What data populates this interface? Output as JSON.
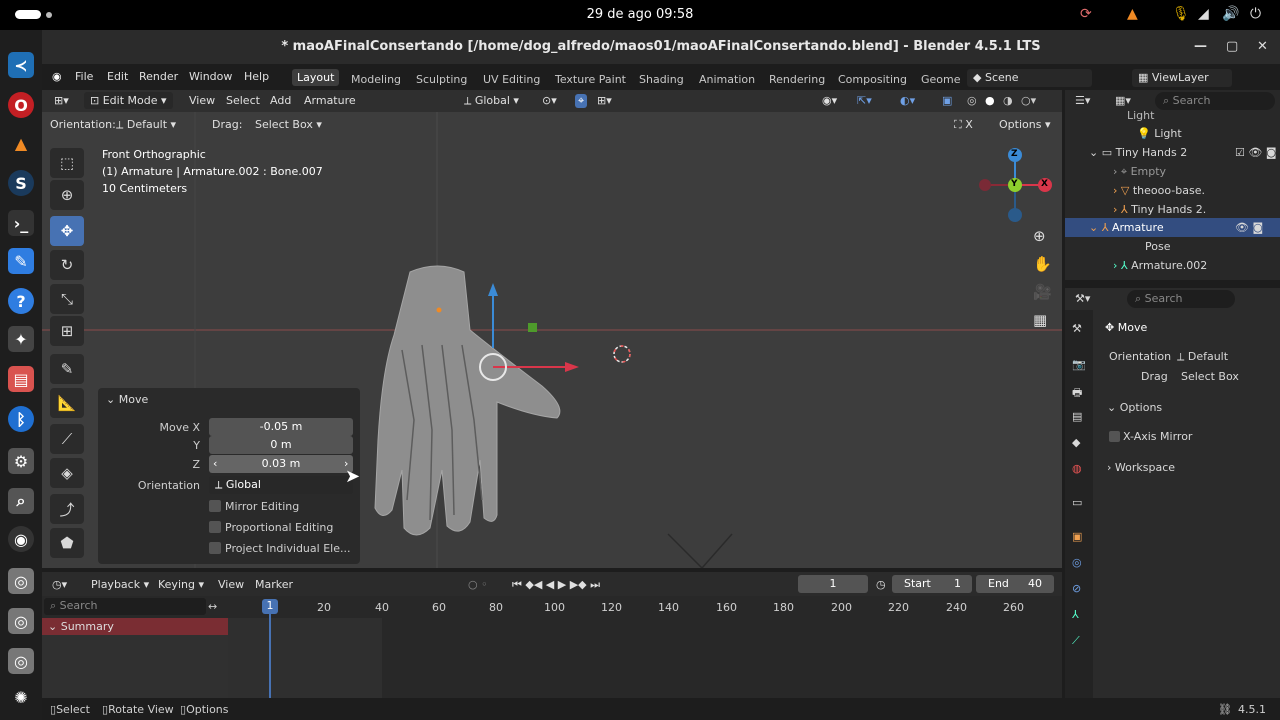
{
  "os": {
    "clock": "29 de ago  09:58"
  },
  "window": {
    "title": "* maoAFinalConsertando [/home/dog_alfredo/maos01/maoAFinalConsertando.blend] - Blender 4.5.1 LTS"
  },
  "menu": [
    "File",
    "Edit",
    "Render",
    "Window",
    "Help"
  ],
  "workspaces": [
    "Layout",
    "Modeling",
    "Sculpting",
    "UV Editing",
    "Texture Paint",
    "Shading",
    "Animation",
    "Rendering",
    "Compositing",
    "Geome"
  ],
  "scene": "Scene",
  "view_layer": "ViewLayer",
  "viewport": {
    "mode": "Edit Mode",
    "menus": [
      "View",
      "Select",
      "Add",
      "Armature"
    ],
    "transform_orientation": "Global",
    "orientation_label": "Orientation:",
    "orientation_value": "Default",
    "drag_label": "Drag:",
    "drag_value": "Select Box",
    "options": "Options",
    "overlay": {
      "view": "Front Orthographic",
      "object": "(1) Armature | Armature.002 : Bone.007",
      "scale": "10 Centimeters"
    },
    "gizmo": {
      "z": "Z",
      "y": "Y",
      "x": "X"
    }
  },
  "operator": {
    "title": "Move",
    "move_x_label": "Move X",
    "move_x": "-0.05 m",
    "y_label": "Y",
    "y": "0 m",
    "z_label": "Z",
    "z": "0.03 m",
    "orientation_label": "Orientation",
    "orientation": "Global",
    "mirror": "Mirror Editing",
    "proportional": "Proportional Editing",
    "project": "Project Individual Ele..."
  },
  "outliner": {
    "search": "Search",
    "items": [
      "Light",
      "Light",
      "Tiny Hands 2",
      "Empty",
      "theooo-base.",
      "Tiny Hands 2.",
      "Armature",
      "Pose",
      "Armature.002"
    ]
  },
  "properties": {
    "search": "Search",
    "tool": "Move",
    "orientation_label": "Orientation",
    "orientation": "Default",
    "drag_label": "Drag",
    "drag": "Select Box",
    "options": "Options",
    "x_mirror": "X-Axis Mirror",
    "workspace": "Workspace"
  },
  "timeline": {
    "menus": [
      "Playback",
      "Keying",
      "View",
      "Marker"
    ],
    "current_frame": "1",
    "start_label": "Start",
    "start": "1",
    "end_label": "End",
    "end": "40",
    "search": "Search",
    "summary": "Summary",
    "ticks": [
      "1",
      "20",
      "40",
      "60",
      "80",
      "100",
      "120",
      "140",
      "160",
      "180",
      "200",
      "220",
      "240",
      "260"
    ]
  },
  "status": {
    "select": "Select",
    "rotate": "Rotate View",
    "options": "Options",
    "version": "4.5.1"
  }
}
